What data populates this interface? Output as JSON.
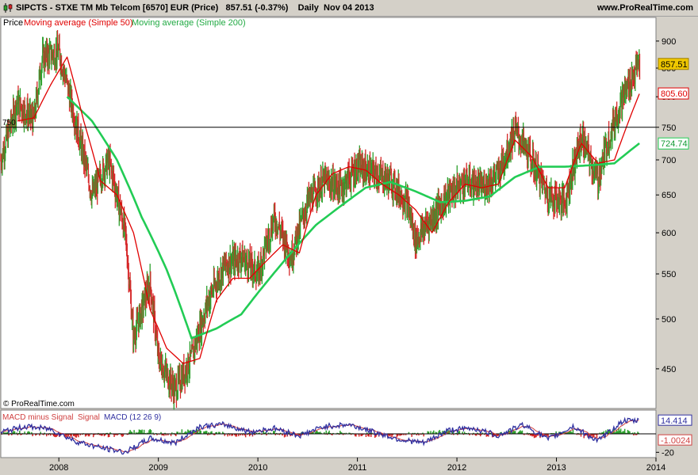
{
  "header": {
    "symbol": "SIPCTS",
    "instrument": "STXE TM Mb Telcom [6570] EUR (Price)",
    "last": "857.51",
    "change": "(-0.37%)",
    "period": "Daily",
    "date": "Nov 04 2013",
    "website": "www.ProRealTime.com"
  },
  "legend": {
    "price": "Price",
    "ma50": "Moving average (Simple 50)",
    "ma200": "Moving average (Simple 200)"
  },
  "copyright": "© ProRealTime.com",
  "macd_legend": {
    "part1": "MACD minus Signal",
    "part2": "Signal",
    "part3": "MACD (12 26 9)"
  },
  "colors": {
    "price_up": "#2ca02c",
    "price_down": "#d62728",
    "ma50": "#e00000",
    "ma200": "#22cc55",
    "macd": "#3030a0",
    "signal": "#d04040",
    "last_badge": "#f0c800"
  },
  "chart_data": [
    {
      "type": "line",
      "name": "price",
      "x_axis_labels": [
        "2008",
        "2009",
        "2010",
        "2011",
        "2012",
        "2013",
        "2014"
      ],
      "y_axis_labels": [
        "450",
        "500",
        "550",
        "600",
        "650",
        "700",
        "750",
        "800",
        "850",
        "900"
      ],
      "ylim": [
        425,
        915
      ],
      "xlim": [
        "2007-06",
        "2014-01"
      ],
      "log_scale": true,
      "horizontal_line": {
        "value": 750,
        "label": "750"
      },
      "badges": {
        "last": "857.51",
        "ma50": "805.60",
        "ma200": "724.74"
      },
      "series": [
        {
          "name": "Price",
          "x": [
            "2007-06",
            "2007-08",
            "2007-10",
            "2007-11",
            "2008-01",
            "2008-03",
            "2008-05",
            "2008-07",
            "2008-09",
            "2008-10",
            "2008-12",
            "2009-01",
            "2009-03",
            "2009-05",
            "2009-07",
            "2009-09",
            "2009-11",
            "2010-01",
            "2010-03",
            "2010-05",
            "2010-07",
            "2010-09",
            "2010-11",
            "2011-01",
            "2011-03",
            "2011-05",
            "2011-07",
            "2011-08",
            "2011-10",
            "2011-12",
            "2012-02",
            "2012-04",
            "2012-06",
            "2012-08",
            "2012-10",
            "2012-12",
            "2013-02",
            "2013-04",
            "2013-06",
            "2013-07",
            "2013-09",
            "2013-11"
          ],
          "values": [
            700,
            790,
            760,
            870,
            880,
            760,
            650,
            700,
            600,
            480,
            540,
            460,
            430,
            460,
            520,
            560,
            570,
            550,
            620,
            570,
            640,
            670,
            660,
            690,
            680,
            670,
            640,
            590,
            620,
            650,
            670,
            660,
            680,
            745,
            700,
            650,
            640,
            735,
            670,
            720,
            800,
            860
          ]
        },
        {
          "name": "Moving average (Simple 50)",
          "x": [
            "2007-08",
            "2007-10",
            "2007-12",
            "2008-02",
            "2008-04",
            "2008-06",
            "2008-08",
            "2008-10",
            "2008-12",
            "2009-02",
            "2009-04",
            "2009-06",
            "2009-08",
            "2009-10",
            "2009-12",
            "2010-02",
            "2010-04",
            "2010-06",
            "2010-08",
            "2010-10",
            "2010-12",
            "2011-02",
            "2011-04",
            "2011-06",
            "2011-08",
            "2011-10",
            "2011-12",
            "2012-02",
            "2012-04",
            "2012-06",
            "2012-08",
            "2012-10",
            "2012-12",
            "2013-02",
            "2013-04",
            "2013-06",
            "2013-08",
            "2013-10",
            "2013-11"
          ],
          "values": [
            760,
            765,
            820,
            870,
            760,
            670,
            650,
            600,
            510,
            470,
            455,
            460,
            520,
            545,
            545,
            565,
            585,
            575,
            650,
            680,
            690,
            685,
            665,
            650,
            630,
            600,
            640,
            665,
            660,
            665,
            730,
            705,
            660,
            660,
            725,
            695,
            700,
            770,
            805
          ]
        },
        {
          "name": "Moving average (Simple 200)",
          "x": [
            "2008-02",
            "2008-05",
            "2008-08",
            "2008-11",
            "2009-02",
            "2009-05",
            "2009-08",
            "2009-11",
            "2010-02",
            "2010-05",
            "2010-08",
            "2010-11",
            "2011-02",
            "2011-05",
            "2011-08",
            "2011-11",
            "2012-02",
            "2012-05",
            "2012-08",
            "2012-11",
            "2013-02",
            "2013-05",
            "2013-08",
            "2013-11"
          ],
          "values": [
            800,
            760,
            700,
            620,
            555,
            480,
            490,
            505,
            540,
            575,
            610,
            635,
            660,
            668,
            655,
            640,
            642,
            648,
            675,
            690,
            690,
            692,
            695,
            725
          ]
        }
      ]
    },
    {
      "type": "line",
      "name": "macd",
      "y_axis_labels": [
        "-20"
      ],
      "ylim": [
        -24,
        24
      ],
      "badges": {
        "macd": "14.414",
        "signal": "-1.0024"
      },
      "series": [
        {
          "name": "MACD (12 26 9)",
          "x": [
            "2007-06",
            "2007-09",
            "2007-12",
            "2008-03",
            "2008-06",
            "2008-09",
            "2008-12",
            "2009-03",
            "2009-06",
            "2009-09",
            "2009-12",
            "2010-03",
            "2010-06",
            "2010-09",
            "2010-12",
            "2011-03",
            "2011-06",
            "2011-09",
            "2011-12",
            "2012-03",
            "2012-06",
            "2012-09",
            "2012-12",
            "2013-03",
            "2013-06",
            "2013-09",
            "2013-11"
          ],
          "values": [
            2,
            8,
            5,
            -8,
            -15,
            -20,
            -5,
            -10,
            8,
            10,
            2,
            6,
            -2,
            8,
            10,
            2,
            -6,
            -10,
            4,
            6,
            -2,
            10,
            -6,
            8,
            -8,
            14,
            14
          ]
        }
      ]
    }
  ]
}
